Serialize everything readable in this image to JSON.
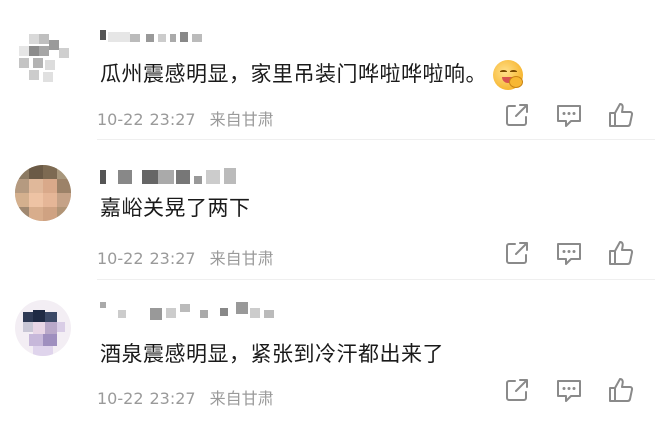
{
  "comments": [
    {
      "text": "瓜州震感明显，家里吊装门哗啦哗啦响。",
      "emoji_icon": "hugging-face-emoji",
      "date": "10-22",
      "time": "23:27",
      "source": "来自甘肃"
    },
    {
      "text": "嘉峪关晃了两下",
      "date": "10-22",
      "time": "23:27",
      "source": "来自甘肃"
    },
    {
      "text": "酒泉震感明显，紧张到冷汗都出来了",
      "date": "10-22",
      "time": "23:27",
      "source": "来自甘肃"
    }
  ],
  "actions": {
    "share_icon": "share-icon",
    "reply_icon": "comment-icon",
    "like_icon": "thumbs-up-icon"
  },
  "colors": {
    "text": "#1a1a1a",
    "meta": "#9a9a9a",
    "icon": "#8a8a8a",
    "background": "#ffffff"
  }
}
